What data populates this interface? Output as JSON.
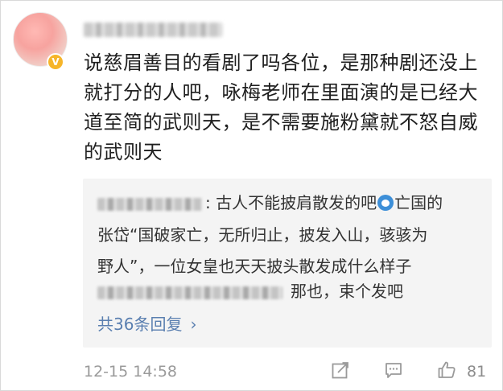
{
  "comment": {
    "text": "说慈眉善目的看剧了吗各位，是那种剧还没上就打分的人吧，咏梅老师在里面演的是已经大道至简的武则天，是不需要施粉黛就不怒自威的武则天",
    "timestamp": "12-15 14:58",
    "like_count": "81",
    "verified_badge": "V"
  },
  "reply_box": {
    "line1": ": 古人不能披肩散发的吧",
    "line1_tail": "亡国的",
    "line2": "张岱“国破家亡，无所归止，披发入山，骇骇为",
    "line3": "野人”，一位女皇也天天披头散发成什么样子",
    "line4": "那也，束个发吧",
    "more_label": "共36条回复",
    "more_chevron": "›"
  },
  "icons": {
    "share": "share-icon",
    "comment": "comment-icon",
    "like": "thumbs-up-icon"
  }
}
